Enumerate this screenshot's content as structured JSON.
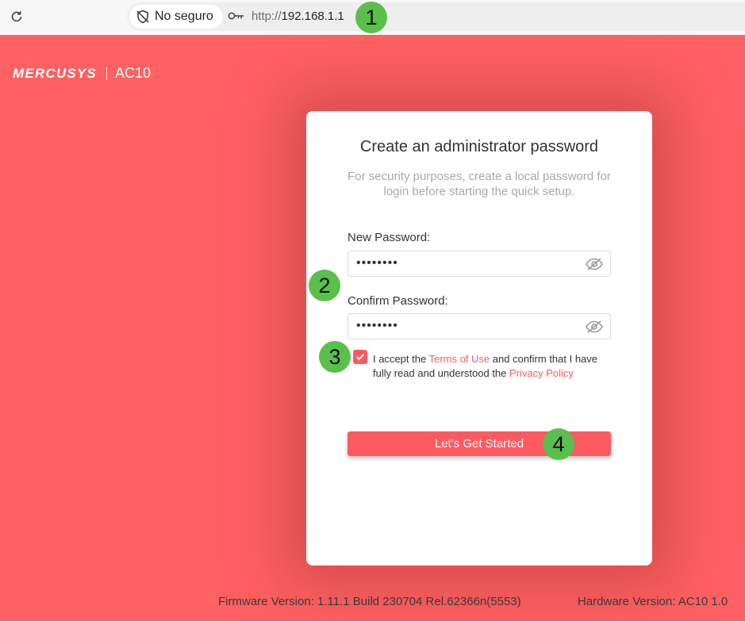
{
  "browser": {
    "security_label": "No seguro",
    "url_protocol": "http://",
    "url_host": "192.168.1.1"
  },
  "brand": {
    "logo": "MERCUSYS",
    "model": "AC10"
  },
  "card": {
    "title": "Create an administrator password",
    "description": "For security purposes, create a local password for login before starting the quick setup.",
    "new_password_label": "New Password:",
    "new_password_value": "••••••••",
    "confirm_password_label": "Confirm Password:",
    "confirm_password_value": "••••••••",
    "terms": {
      "checked": true,
      "text_1": "I accept the ",
      "terms_link": "Terms of Use",
      "text_2": " and confirm that I have fully read and understood the ",
      "privacy_link": "Privacy Policy"
    },
    "start_button": "Let's Get Started"
  },
  "footer": {
    "firmware": "Firmware Version: 1.11.1 Build 230704 Rel.62366n(5553)",
    "hardware": "Hardware Version: AC10 1.0"
  },
  "annotations": {
    "badge_1": "1",
    "badge_2": "2",
    "badge_3": "3",
    "badge_4": "4"
  },
  "colors": {
    "page_background": "#ff6162",
    "accent": "#ff5a5f",
    "badge": "#59c04c"
  },
  "icons": {
    "reload": "reload-icon",
    "shield": "shield-off-icon",
    "key": "key-icon",
    "eye": "eye-slash-icon",
    "check": "checkmark-icon"
  }
}
